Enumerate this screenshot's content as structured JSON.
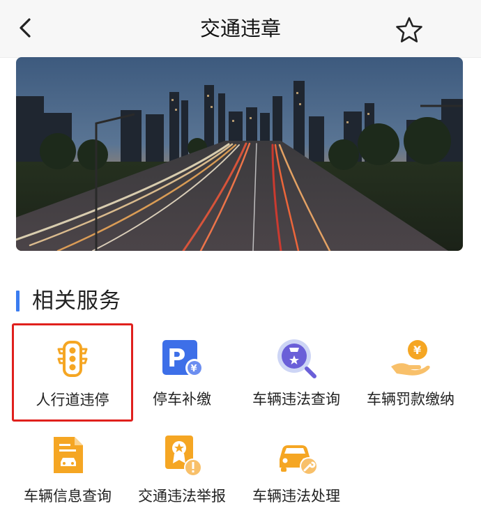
{
  "header": {
    "title": "交通违章"
  },
  "section": {
    "title": "相关服务"
  },
  "services": [
    {
      "label": "人行道违停",
      "icon": "traffic-light-icon",
      "highlighted": true
    },
    {
      "label": "停车补缴",
      "icon": "parking-payment-icon"
    },
    {
      "label": "车辆违法查询",
      "icon": "violation-search-icon"
    },
    {
      "label": "车辆罚款缴纳",
      "icon": "hand-coin-icon"
    },
    {
      "label": "车辆信息查询",
      "icon": "vehicle-document-icon"
    },
    {
      "label": "交通违法举报",
      "icon": "report-badge-icon"
    },
    {
      "label": "车辆违法处理",
      "icon": "car-wrench-icon"
    }
  ],
  "colors": {
    "accent": "#3a7cf0",
    "icon_orange": "#f5a623",
    "icon_blue": "#3d6fe8",
    "icon_purple": "#6a5fd8",
    "highlight": "#e0201d"
  }
}
